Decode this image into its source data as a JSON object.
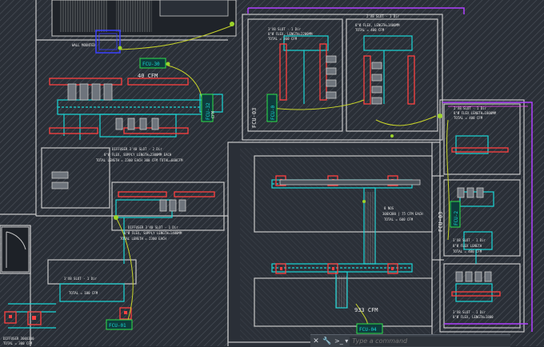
{
  "drawing": {
    "equipment_tags": {
      "fcu_30": "FCU-30",
      "fcu_32": "FCU-32",
      "fcu_01": "FCU-01",
      "fcu_04": "FCU-04",
      "fcu_cut_a": "FCU-0",
      "fcu_cut_b": "FCU-2",
      "vav_left": "FCU-03",
      "vav_right": "FCU-03"
    },
    "airflow_labels": {
      "cfm_top_left": "40 CFM",
      "cfm_tag": "CFM",
      "cfm_center": "933 CFM"
    },
    "notes": {
      "wall_mounted": "WALL MOUNTED",
      "top_right_a": "2'X8 SLOT - 1 Dir",
      "top_right_b": "8\"Ø FLEX, LENGTH=1400MM",
      "top_right_c": "TOTAL = 400 CFM",
      "mid_a": "3'X8 SLOT - 1 Dir",
      "mid_b": "8\"Ø FLEX, LENGTH=2200MM",
      "mid_c": "TOTAL = 360 CFM",
      "right_a": "2'X8 SLOT - 1 Dir",
      "right_b": "8\"Ø FLEX LENGTH=1800MM",
      "right_c": "TOTAL = 400 CFM",
      "left_a": "DIFFUSER 3'X8 SLOT - 2 Dir",
      "left_b": "8\"Ø FLEX, SUPPLY LENGTH=2300MM EACH",
      "left_c": "TOTAL LENGTH = 2300 EACH 300 CFM TOTAL=600CFM",
      "left2_a": "DIFFUSER 3'X8 SLOT - 1 Dir",
      "left2_b": "8\"Ø FLEX, SUPPLY LENGTH=1400MM",
      "left2_c": "TOTAL LENGTH = 2300 EACH",
      "center_a": "8 NOS",
      "center_b": "300X300 | 75 CFM EACH",
      "center_c": "TOTAL = 600 CFM",
      "right2_a": "3'X8 SLOT - 1 Dir",
      "right2_b": "8\"Ø FLEX LENGTH",
      "right2_c": "TOTAL = 400 CFM",
      "right3_a": "3'X8 SLOT - 1 Dir",
      "right3_b": "8\"Ø FLEX, LENGTH=1800",
      "bottom_left_a": "3'X8 SLOT - 1 Dir",
      "bottom_left_b": "TOTAL = 100 CFM",
      "bottom_left_c": "DIFFUSER 300X300",
      "bottom_left_d": "TOTAL = 300 CFM",
      "top_mid": "2'X8 SLOT - 1 Dir"
    }
  },
  "command_line": {
    "placeholder": "Type a command",
    "close_icon": "close-icon",
    "wrench_icon": "wrench-icon",
    "prompt_icon": "command-prompt-icon"
  },
  "colors": {
    "background": "#2a2f37",
    "wall": "#c8c8c8",
    "duct": "#19d7d7",
    "diffuser": "#ff4040",
    "boundary": "#b040ff",
    "leader": "#c8d42a",
    "equipment": "#2ee04a"
  }
}
